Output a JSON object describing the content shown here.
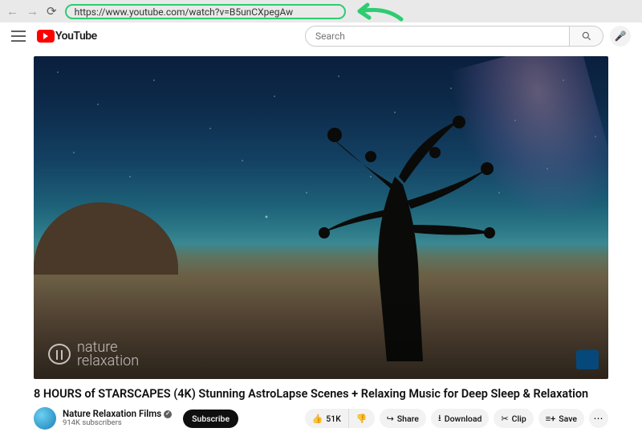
{
  "browser": {
    "url": "https://www.youtube.com/watch?v=B5unCXpegAw"
  },
  "masthead": {
    "logo_text": "YouTube",
    "search_placeholder": "Search"
  },
  "video": {
    "title": "8 HOURS of STARSCAPES (4K) Stunning AstroLapse Scenes + Relaxing Music for Deep Sleep & Relaxation",
    "watermark_line1": "nature",
    "watermark_line2": "relaxation"
  },
  "channel": {
    "name": "Nature Relaxation Films",
    "subscribers": "914K subscribers"
  },
  "buttons": {
    "subscribe": "Subscribe",
    "like_count": "51K",
    "share": "Share",
    "download": "Download",
    "clip": "Clip",
    "save": "Save"
  }
}
